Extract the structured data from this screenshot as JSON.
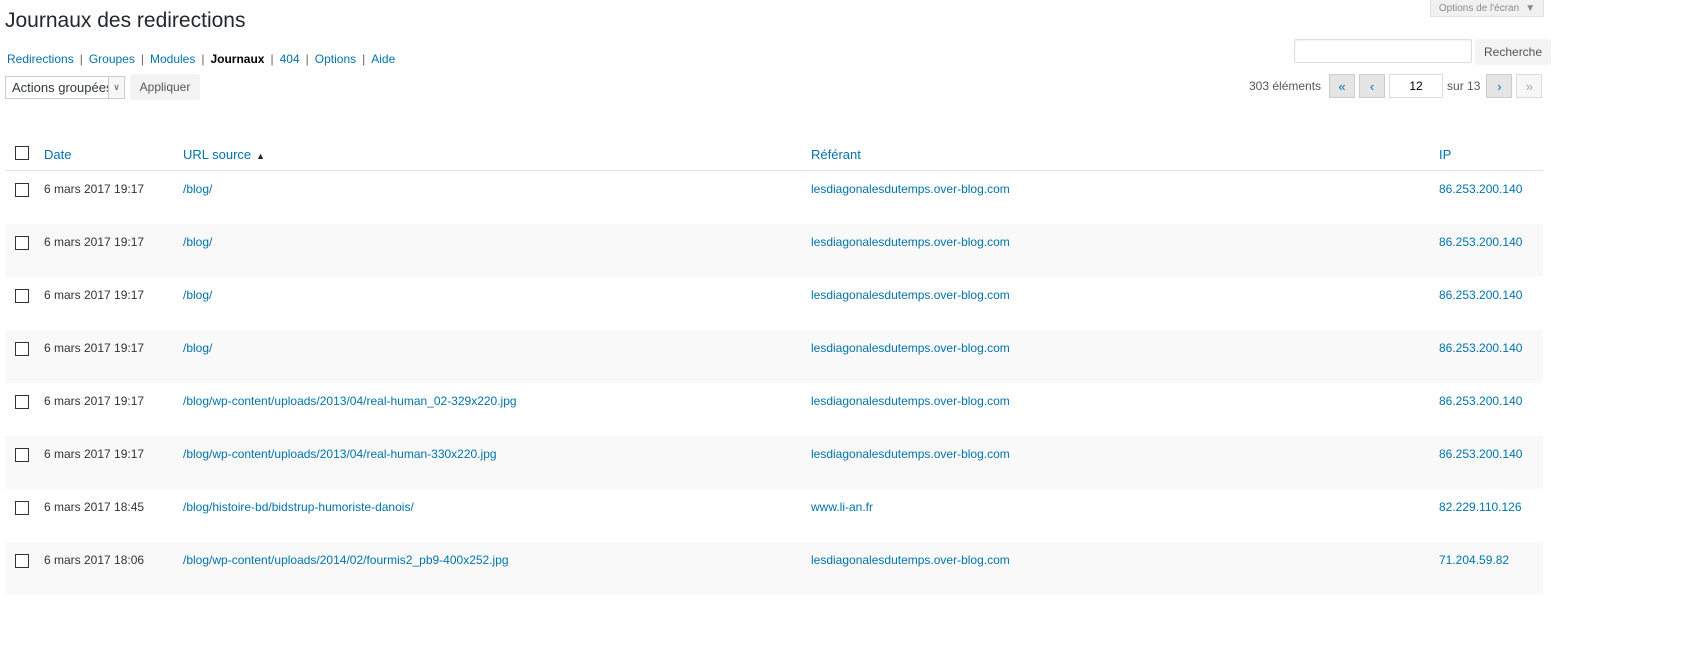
{
  "screen_options": {
    "label": "Options de l'écran"
  },
  "page_title": "Journaux des redirections",
  "subnav": [
    {
      "label": "Redirections",
      "current": false
    },
    {
      "label": "Groupes",
      "current": false
    },
    {
      "label": "Modules",
      "current": false
    },
    {
      "label": "Journaux",
      "current": true
    },
    {
      "label": "404",
      "current": false
    },
    {
      "label": "Options",
      "current": false
    },
    {
      "label": "Aide",
      "current": false
    }
  ],
  "search": {
    "value": "",
    "button_label": "Recherche"
  },
  "bulk_actions": {
    "selected": "Actions groupées",
    "apply_label": "Appliquer"
  },
  "pagination": {
    "count_label": "303 éléments",
    "first": "«",
    "prev": "‹",
    "next": "›",
    "last": "»",
    "current_page": "12",
    "total_label": "sur 13"
  },
  "table": {
    "columns": {
      "date": "Date",
      "url": "URL source",
      "referrer": "Référant",
      "ip": "IP"
    },
    "rows": [
      {
        "date": "6 mars 2017 19:17",
        "url": "/blog/",
        "referrer": "lesdiagonalesdutemps.over-blog.com",
        "ip": "86.253.200.140"
      },
      {
        "date": "6 mars 2017 19:17",
        "url": "/blog/",
        "referrer": "lesdiagonalesdutemps.over-blog.com",
        "ip": "86.253.200.140"
      },
      {
        "date": "6 mars 2017 19:17",
        "url": "/blog/",
        "referrer": "lesdiagonalesdutemps.over-blog.com",
        "ip": "86.253.200.140"
      },
      {
        "date": "6 mars 2017 19:17",
        "url": "/blog/",
        "referrer": "lesdiagonalesdutemps.over-blog.com",
        "ip": "86.253.200.140"
      },
      {
        "date": "6 mars 2017 19:17",
        "url": "/blog/wp-content/uploads/2013/04/real-human_02-329x220.jpg",
        "referrer": "lesdiagonalesdutemps.over-blog.com",
        "ip": "86.253.200.140"
      },
      {
        "date": "6 mars 2017 19:17",
        "url": "/blog/wp-content/uploads/2013/04/real-human-330x220.jpg",
        "referrer": "lesdiagonalesdutemps.over-blog.com",
        "ip": "86.253.200.140"
      },
      {
        "date": "6 mars 2017 18:45",
        "url": "/blog/histoire-bd/bidstrup-humoriste-danois/",
        "referrer": "www.li-an.fr",
        "ip": "82.229.110.126"
      },
      {
        "date": "6 mars 2017 18:06",
        "url": "/blog/wp-content/uploads/2014/02/fourmis2_pb9-400x252.jpg",
        "referrer": "lesdiagonalesdutemps.over-blog.com",
        "ip": "71.204.59.82"
      }
    ]
  }
}
